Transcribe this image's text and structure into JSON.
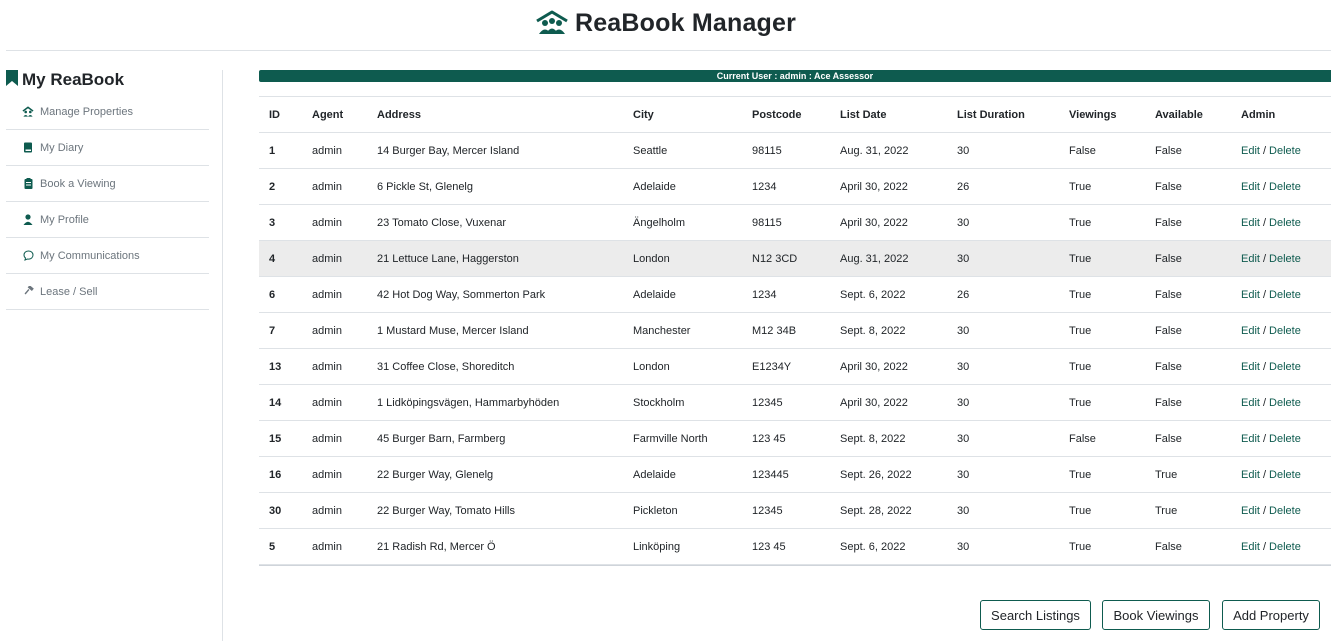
{
  "app": {
    "title": "ReaBook Manager"
  },
  "colors": {
    "accent": "#0e5b4f",
    "highlight_row": "#ececec"
  },
  "sidebar": {
    "title": "My ReaBook",
    "title_icon": "bookmark-icon",
    "items": [
      {
        "label": "Manage Properties",
        "icon": "house-icon"
      },
      {
        "label": "My Diary",
        "icon": "book-icon"
      },
      {
        "label": "Book a Viewing",
        "icon": "clipboard-icon"
      },
      {
        "label": "My Profile",
        "icon": "person-icon"
      },
      {
        "label": "My Communications",
        "icon": "chat-icon"
      },
      {
        "label": "Lease / Sell",
        "icon": "hammer-icon"
      }
    ]
  },
  "user_bar": {
    "text": "Current User : admin : Ace Assessor"
  },
  "table": {
    "headers": [
      "ID",
      "Agent",
      "Address",
      "City",
      "Postcode",
      "List Date",
      "List Duration",
      "Viewings",
      "Available",
      "Admin"
    ],
    "edit_label": "Edit",
    "delete_label": "Delete",
    "separator": "/",
    "rows": [
      [
        "1",
        "admin",
        "14 Burger Bay, Mercer Island",
        "Seattle",
        "98115",
        "Aug. 31, 2022",
        "30",
        "False",
        "False"
      ],
      [
        "2",
        "admin",
        "6 Pickle St, Glenelg",
        "Adelaide",
        "1234",
        "April 30, 2022",
        "26",
        "True",
        "False"
      ],
      [
        "3",
        "admin",
        "23 Tomato Close, Vuxenar",
        "Ängelholm",
        "98115",
        "April 30, 2022",
        "30",
        "True",
        "False"
      ],
      [
        "4",
        "admin",
        "21 Lettuce Lane, Haggerston",
        "London",
        "N12 3CD",
        "Aug. 31, 2022",
        "30",
        "True",
        "False"
      ],
      [
        "6",
        "admin",
        "42 Hot Dog Way, Sommerton Park",
        "Adelaide",
        "1234",
        "Sept. 6, 2022",
        "26",
        "True",
        "False"
      ],
      [
        "7",
        "admin",
        "1 Mustard Muse, Mercer Island",
        "Manchester",
        "M12 34B",
        "Sept. 8, 2022",
        "30",
        "True",
        "False"
      ],
      [
        "13",
        "admin",
        "31 Coffee Close, Shoreditch",
        "London",
        "E1234Y",
        "April 30, 2022",
        "30",
        "True",
        "False"
      ],
      [
        "14",
        "admin",
        "1 Lidköpingsvägen, Hammarbyhöden",
        "Stockholm",
        "12345",
        "April 30, 2022",
        "30",
        "True",
        "False"
      ],
      [
        "15",
        "admin",
        "45 Burger Barn, Farmberg",
        "Farmville North",
        "123 45",
        "Sept. 8, 2022",
        "30",
        "False",
        "False"
      ],
      [
        "16",
        "admin",
        "22 Burger Way, Glenelg",
        "Adelaide",
        "123445",
        "Sept. 26, 2022",
        "30",
        "True",
        "True"
      ],
      [
        "30",
        "admin",
        "22 Burger Way, Tomato Hills",
        "Pickleton",
        "12345",
        "Sept. 28, 2022",
        "30",
        "True",
        "True"
      ],
      [
        "5",
        "admin",
        "21 Radish Rd, Mercer Ö",
        "Linköping",
        "123 45",
        "Sept. 6, 2022",
        "30",
        "True",
        "False"
      ]
    ]
  },
  "actions": {
    "search_listings": "Search Listings",
    "book_viewings": "Book Viewings",
    "add_property": "Add Property"
  }
}
